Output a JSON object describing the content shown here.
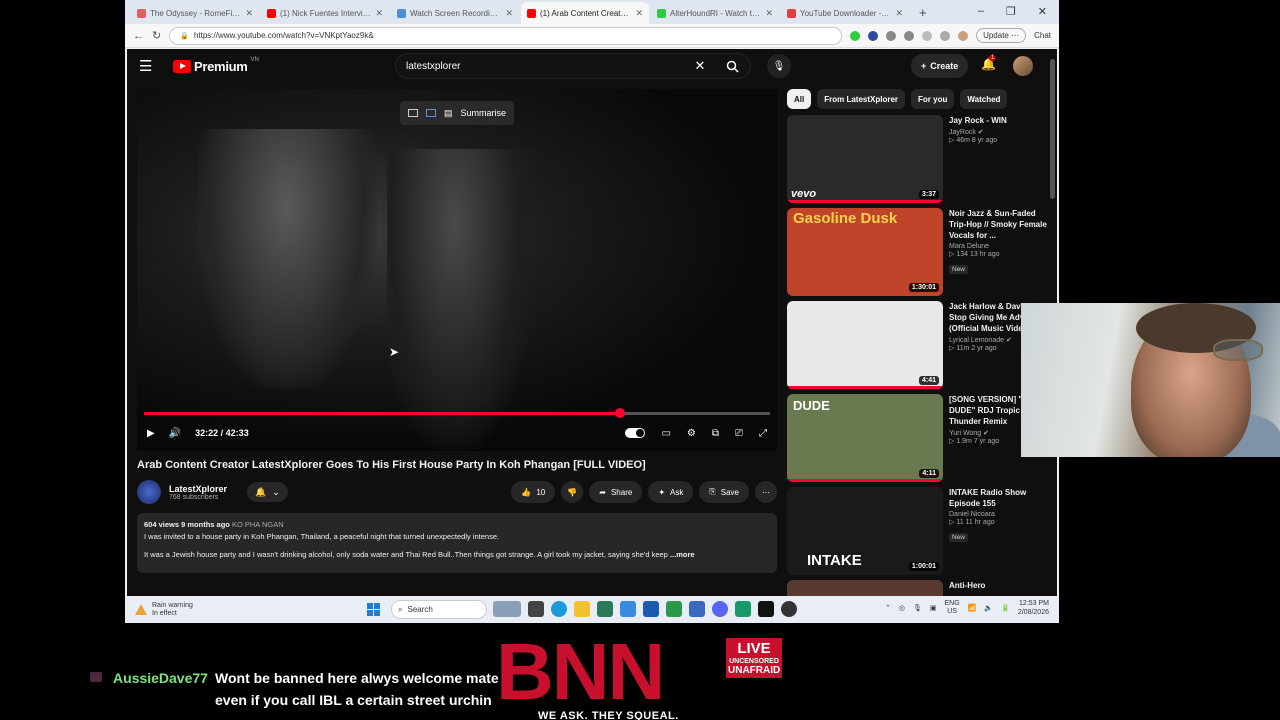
{
  "browser": {
    "tabs": [
      {
        "label": "The Odyssey - RomeFilx - W",
        "color": "#e06060"
      },
      {
        "label": "(1) Nick Fuentes Interview (ft.",
        "color": "#ff0000"
      },
      {
        "label": "Watch Screen Recording 202",
        "color": "#4a90d9"
      },
      {
        "label": "(1) Arab Content Creator Late",
        "color": "#ff0000"
      },
      {
        "label": "AlterHoundRI - Watch the VC",
        "color": "#2ecc40"
      },
      {
        "label": "YouTube Downloader - Down",
        "color": "#e04040"
      }
    ],
    "url": "https://www.youtube.com/watch?v=VNKptYaoz9k&",
    "update_label": "Update",
    "chat_label": "Chat"
  },
  "youtube": {
    "logo_text": "Premium",
    "logo_region": "VN",
    "search_value": "latestxplorer",
    "create_label": "Create",
    "notif_count": "1",
    "summarise_label": "Summarise",
    "time": "32:22 / 42:33",
    "progress": 0.76,
    "title": "Arab Content Creator LatestXplorer Goes To His First House Party In Koh Phangan [FULL VIDEO]",
    "channel_name": "LatestXplorer",
    "subscribers": "768 subscribers",
    "like_count": "10",
    "share_label": "Share",
    "ask_label": "Ask",
    "save_label": "Save",
    "description": {
      "meta": "604 views  9 months ago",
      "tag": "KO PHA NGAN",
      "line1": "I was invited to a house party in Koh Phangan, Thailand, a peaceful night that turned unexpectedly intense.",
      "line2": "It was a Jewish house party and I wasn't drinking alcohol, only soda water and Thai Red Bull..Then things got strange. A girl took my jacket, saying she'd keep",
      "more": "...more"
    },
    "chips": [
      "All",
      "From LatestXplorer",
      "For you",
      "Watched"
    ],
    "recommendations": [
      {
        "title": "Jay Rock - WIN",
        "channel": "JayRock",
        "verified": true,
        "stats": "46m  8 yr ago",
        "duration": "3:37",
        "is_new": false,
        "thumb_label": "vevo",
        "thumb_bg": "#2a2a2a",
        "progress": 1.0
      },
      {
        "title": "Noir Jazz & Sun-Faded Trip-Hop // Smoky Female Vocals for ...",
        "channel": "Mara Delune",
        "verified": false,
        "stats": "134  13 hr ago",
        "duration": "1:30:01",
        "is_new": true,
        "thumb_label": "Gasoline Dusk",
        "thumb_bg": "#c0442a",
        "progress": 0
      },
      {
        "title": "Jack Harlow & Dave - Stop Giving Me Advice (Official Music Video)",
        "channel": "Lyrical Lemonade",
        "verified": true,
        "stats": "11m  2 yr ago",
        "duration": "4:41",
        "is_new": false,
        "thumb_label": "",
        "thumb_bg": "#e8e8e8",
        "progress": 1.0
      },
      {
        "title": "[SONG VERSION] \"I'M A DUDE\" RDJ Tropic Thunder Remix",
        "channel": "Yuri Wong",
        "verified": true,
        "stats": "1.9m  7 yr ago",
        "duration": "4:11",
        "is_new": false,
        "thumb_label": "DUDE",
        "thumb_bg": "#6a7a50",
        "progress": 1.0
      },
      {
        "title": "INTAKE Radio Show Episode 155",
        "channel": "Daniel Nicoara",
        "verified": false,
        "stats": "11  11 hr ago",
        "duration": "1:00:01",
        "is_new": true,
        "thumb_label": "INTAKE",
        "thumb_bg": "#1a1a1a",
        "progress": 0
      },
      {
        "title": "Anti-Hero",
        "channel": "",
        "verified": false,
        "stats": "",
        "duration": "",
        "is_new": false,
        "thumb_label": "",
        "thumb_bg": "#5a3a30",
        "progress": 0
      }
    ]
  },
  "taskbar": {
    "weather_line1": "Rain warning",
    "weather_line2": "In effect",
    "search_label": "Search",
    "lang_line1": "ENG",
    "lang_line2": "US",
    "time": "12:53 PM",
    "date": "2/08/2026"
  },
  "overlay": {
    "chat_user": "AussieDave77",
    "chat_line1": "Wont be banned here alwys welcome mate",
    "chat_line2": "even if you call IBL a certain street urchin",
    "bnn_letters": "BNN",
    "bnn_live": "LIVE",
    "bnn_uncensored": "UNCENSORED",
    "bnn_unafraid": "UNAFRAID",
    "bnn_tagline": "WE ASK. THEY SQUEAL."
  }
}
